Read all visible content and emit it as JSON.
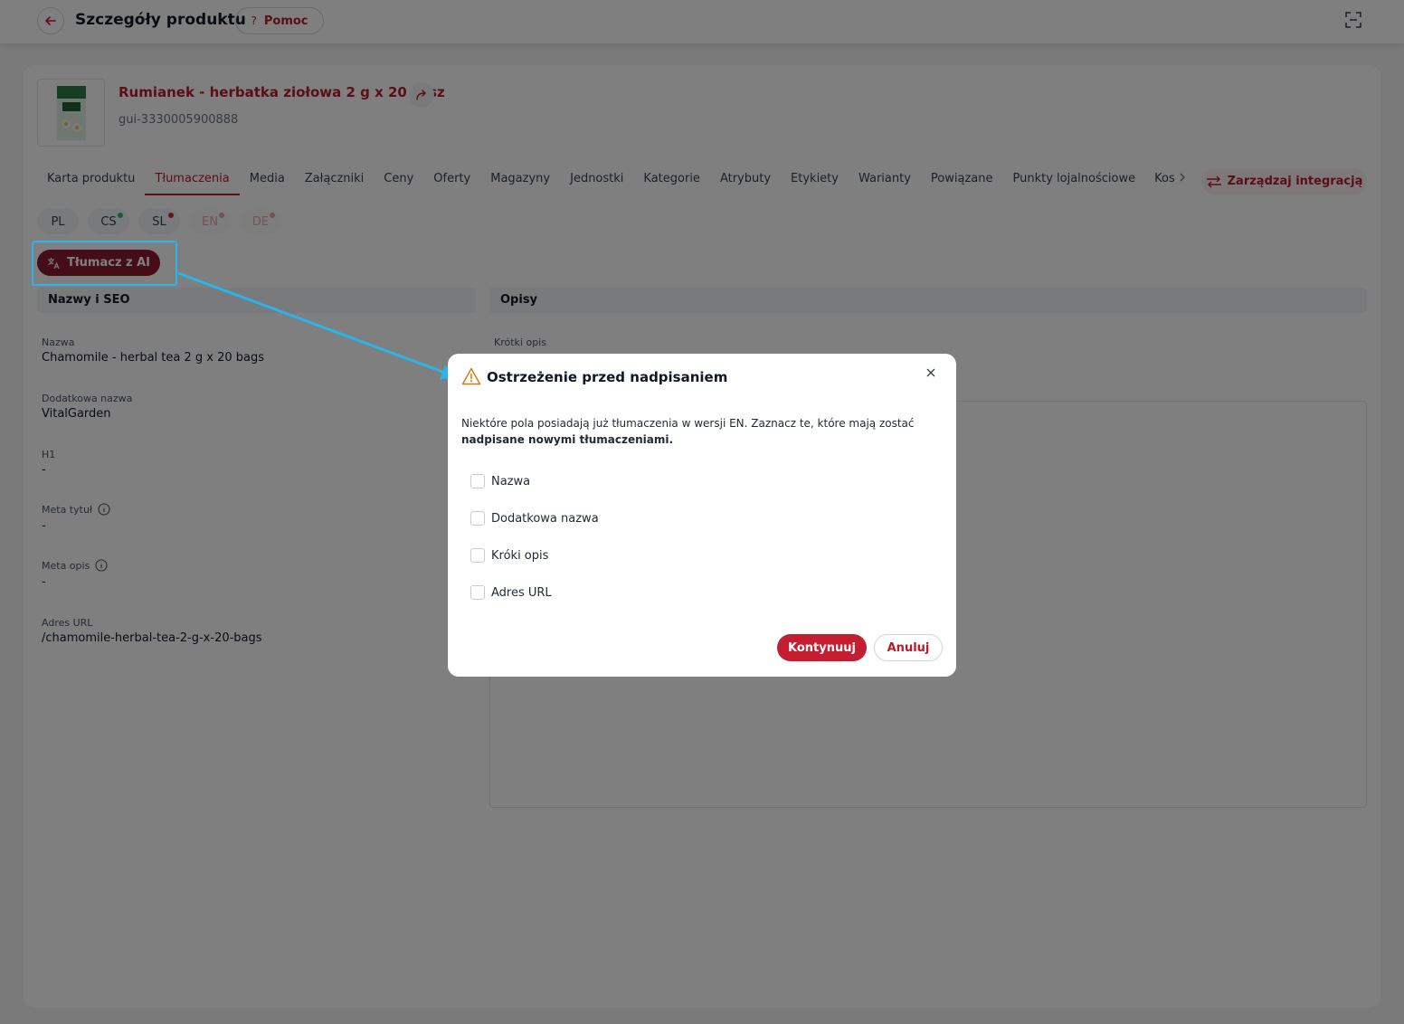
{
  "header": {
    "title": "Szczegóły produktu",
    "help_label": "Pomoc",
    "help_glyph": "?"
  },
  "product": {
    "name": "Rumianek - herbatka ziołowa 2 g x 20 sasz",
    "code": "gui-3330005900888"
  },
  "tabs": [
    {
      "label": "Karta produktu",
      "active": false
    },
    {
      "label": "Tłumaczenia",
      "active": true
    },
    {
      "label": "Media",
      "active": false
    },
    {
      "label": "Załączniki",
      "active": false
    },
    {
      "label": "Ceny",
      "active": false
    },
    {
      "label": "Oferty",
      "active": false
    },
    {
      "label": "Magazyny",
      "active": false
    },
    {
      "label": "Jednostki",
      "active": false
    },
    {
      "label": "Kategorie",
      "active": false
    },
    {
      "label": "Atrybuty",
      "active": false
    },
    {
      "label": "Etykiety",
      "active": false
    },
    {
      "label": "Warianty",
      "active": false
    },
    {
      "label": "Powiązane",
      "active": false
    },
    {
      "label": "Punkty lojalnościowe",
      "active": false
    }
  ],
  "tab_more": "Kos",
  "integration_button": "Zarządzaj integracją",
  "languages": [
    {
      "code": "PL",
      "dot": null
    },
    {
      "code": "CS",
      "dot": "#22c55e"
    },
    {
      "code": "SL",
      "dot": "#dc2626"
    },
    {
      "code": "EN",
      "dot": "#e8a3aa"
    },
    {
      "code": "DE",
      "dot": "#e8a3aa"
    }
  ],
  "ai_button": "Tłumacz z AI",
  "sections": {
    "names": "Nazwy i SEO",
    "descriptions": "Opisy"
  },
  "fields": {
    "name_label": "Nazwa",
    "name_value": "Chamomile - herbal tea 2 g x 20 bags",
    "extra_name_label": "Dodatkowa nazwa",
    "extra_name_value": "VitalGarden",
    "h1_label": "H1",
    "h1_value": "-",
    "meta_title_label": "Meta tytuł",
    "meta_title_value": "-",
    "meta_desc_label": "Meta opis",
    "meta_desc_value": "-",
    "url_label": "Adres URL",
    "url_value": "/chamomile-herbal-tea-2-g-x-20-bags",
    "short_desc_label": "Krótki opis"
  },
  "modal": {
    "title": "Ostrzeżenie przed nadpisaniem",
    "text_part1": "Niektóre pola posiadają już tłumaczenia w wersji EN. Zaznacz te, które mają zostać",
    "text_part2": "nadpisane nowymi tłumaczeniami.",
    "options": [
      "Nazwa",
      "Dodatkowa nazwa",
      "Króki opis",
      "Adres URL"
    ],
    "continue_label": "Kontynuuj",
    "cancel_label": "Anuluj"
  },
  "colors": {
    "brand": "#b91c2b",
    "ai_button": "#8b1a35",
    "annotation": "#2ab4ea"
  }
}
